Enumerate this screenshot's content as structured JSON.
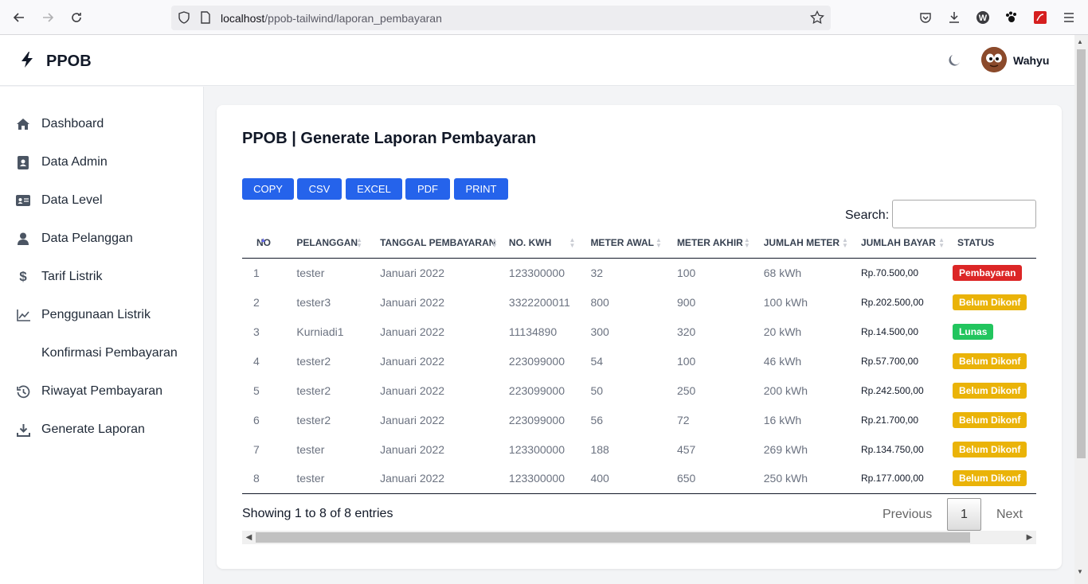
{
  "browser": {
    "url_host": "localhost",
    "url_path": "/ppob-tailwind/laporan_pembayaran"
  },
  "header": {
    "brand": "PPOB",
    "user_name": "Wahyu"
  },
  "sidebar": {
    "items": [
      {
        "label": "Dashboard",
        "icon": "home-icon"
      },
      {
        "label": "Data Admin",
        "icon": "id-card-icon"
      },
      {
        "label": "Data Level",
        "icon": "address-card-icon"
      },
      {
        "label": "Data Pelanggan",
        "icon": "user-icon"
      },
      {
        "label": "Tarif Listrik",
        "icon": "dollar-icon"
      },
      {
        "label": "Penggunaan Listrik",
        "icon": "chart-line-icon"
      },
      {
        "label": "Konfirmasi Pembayaran",
        "icon": ""
      },
      {
        "label": "Riwayat Pembayaran",
        "icon": "history-icon"
      },
      {
        "label": "Generate Laporan",
        "icon": "download-icon"
      }
    ]
  },
  "main": {
    "title": "PPOB | Generate Laporan Pembayaran",
    "buttons": [
      "COPY",
      "CSV",
      "EXCEL",
      "PDF",
      "PRINT"
    ],
    "search_label": "Search:",
    "search_value": "",
    "columns": [
      "NO",
      "PELANGGAN",
      "TANGGAL PEMBAYARAN",
      "NO. KWH",
      "METER AWAL",
      "METER AKHIR",
      "JUMLAH METER",
      "JUMLAH BAYAR",
      "STATUS"
    ],
    "rows": [
      {
        "no": "1",
        "pelanggan": "tester",
        "tanggal": "Januari 2022",
        "kwh": "123300000",
        "awal": "32",
        "akhir": "100",
        "jumlah": "68 kWh",
        "bayar": "Rp.70.500,00",
        "status": "Pembayaran",
        "status_color": "red"
      },
      {
        "no": "2",
        "pelanggan": "tester3",
        "tanggal": "Januari 2022",
        "kwh": "3322200011",
        "awal": "800",
        "akhir": "900",
        "jumlah": "100 kWh",
        "bayar": "Rp.202.500,00",
        "status": "Belum Dikonf",
        "status_color": "yellow"
      },
      {
        "no": "3",
        "pelanggan": "Kurniadi1",
        "tanggal": "Januari 2022",
        "kwh": "11134890",
        "awal": "300",
        "akhir": "320",
        "jumlah": "20 kWh",
        "bayar": "Rp.14.500,00",
        "status": "Lunas",
        "status_color": "green"
      },
      {
        "no": "4",
        "pelanggan": "tester2",
        "tanggal": "Januari 2022",
        "kwh": "223099000",
        "awal": "54",
        "akhir": "100",
        "jumlah": "46 kWh",
        "bayar": "Rp.57.700,00",
        "status": "Belum Dikonf",
        "status_color": "yellow"
      },
      {
        "no": "5",
        "pelanggan": "tester2",
        "tanggal": "Januari 2022",
        "kwh": "223099000",
        "awal": "50",
        "akhir": "250",
        "jumlah": "200 kWh",
        "bayar": "Rp.242.500,00",
        "status": "Belum Dikonf",
        "status_color": "yellow"
      },
      {
        "no": "6",
        "pelanggan": "tester2",
        "tanggal": "Januari 2022",
        "kwh": "223099000",
        "awal": "56",
        "akhir": "72",
        "jumlah": "16 kWh",
        "bayar": "Rp.21.700,00",
        "status": "Belum Dikonf",
        "status_color": "yellow"
      },
      {
        "no": "7",
        "pelanggan": "tester",
        "tanggal": "Januari 2022",
        "kwh": "123300000",
        "awal": "188",
        "akhir": "457",
        "jumlah": "269 kWh",
        "bayar": "Rp.134.750,00",
        "status": "Belum Dikonf",
        "status_color": "yellow"
      },
      {
        "no": "8",
        "pelanggan": "tester",
        "tanggal": "Januari 2022",
        "kwh": "123300000",
        "awal": "400",
        "akhir": "650",
        "jumlah": "250 kWh",
        "bayar": "Rp.177.000,00",
        "status": "Belum Dikonf",
        "status_color": "yellow"
      }
    ],
    "info": "Showing 1 to 8 of 8 entries",
    "pagination": {
      "previous": "Previous",
      "page": "1",
      "next": "Next"
    }
  }
}
